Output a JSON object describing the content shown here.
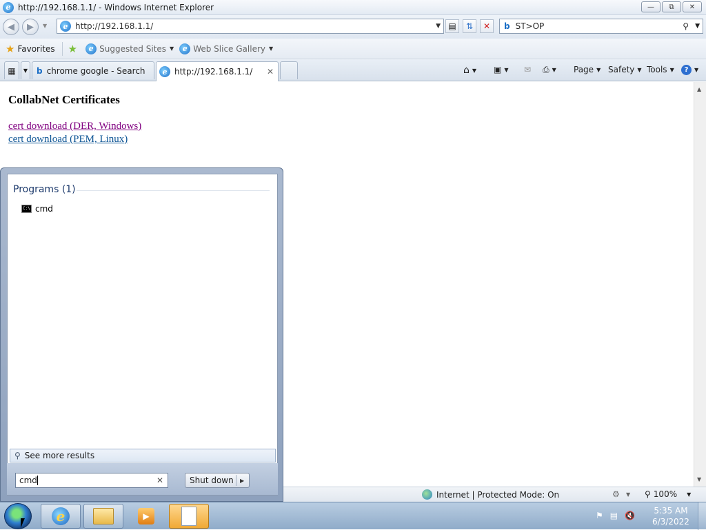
{
  "window": {
    "title": "http://192.168.1.1/ - Windows Internet Explorer",
    "controls": [
      "minimize",
      "restore",
      "close"
    ]
  },
  "nav": {
    "address": "http://192.168.1.1/",
    "search_value": "ST>OP",
    "search_provider": "b"
  },
  "favorites_bar": {
    "favorites_label": "Favorites",
    "suggested_sites_label": "Suggested Sites",
    "web_slice_label": "Web Slice Gallery"
  },
  "tabs": [
    {
      "label": "chrome google - Search",
      "active": false
    },
    {
      "label": "http://192.168.1.1/",
      "active": true
    }
  ],
  "command_bar": {
    "page_label": "Page",
    "safety_label": "Safety",
    "tools_label": "Tools"
  },
  "page": {
    "heading": "CollabNet Certificates",
    "links": [
      {
        "label": "cert download (DER, Windows)",
        "visited": true
      },
      {
        "label": "cert download (PEM, Linux)",
        "visited": false
      }
    ]
  },
  "status": {
    "zone_text": "Internet | Protected Mode: On",
    "zoom": "100%"
  },
  "start_menu": {
    "programs_heading": "Programs (1)",
    "program_item": "cmd",
    "see_more": "See more results",
    "search_value": "cmd",
    "shutdown_label": "Shut down"
  },
  "taskbar": {
    "time": "5:35 AM",
    "date": "6/3/2022"
  },
  "colors": {
    "visited_link": "#800080",
    "link": "#0b5394",
    "taskbar": "#8fabc9",
    "start_menu_heading": "#1e3b6d"
  }
}
